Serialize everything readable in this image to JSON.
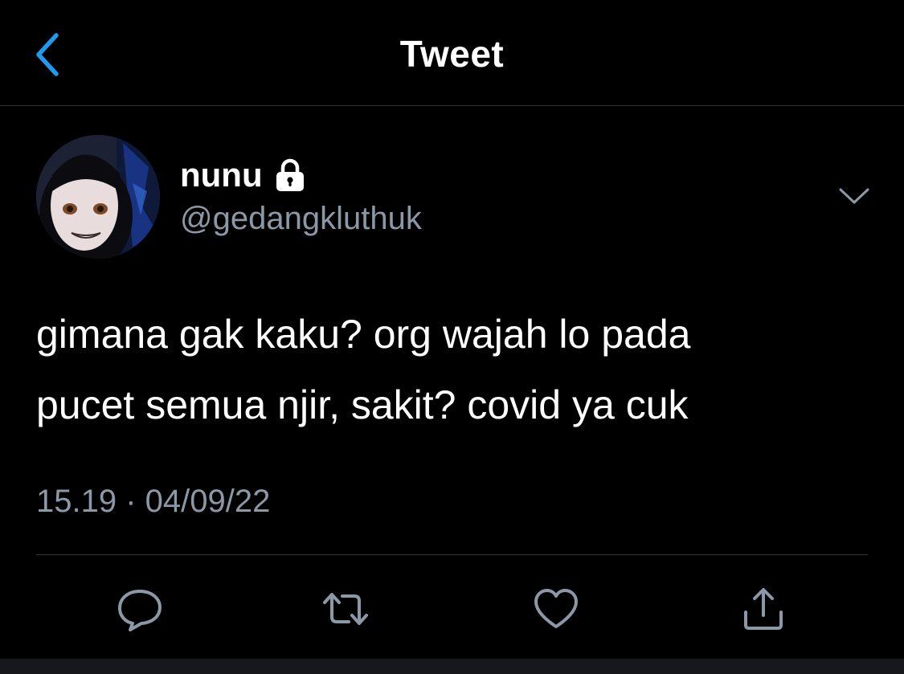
{
  "header": {
    "title": "Tweet",
    "back_icon": "chevron-left-icon",
    "accent_color": "#1d9bf0"
  },
  "tweet": {
    "display_name": "nunu",
    "protected_icon": "lock-icon",
    "handle": "@gedangkluthuk",
    "text": "gimana gak kaku? org wajah lo pada\npucet semua njir, sakit? covid ya cuk",
    "timestamp": "15.19 · 04/09/22",
    "menu_icon": "chevron-down-icon"
  },
  "actions": [
    {
      "name": "reply",
      "icon": "reply-icon"
    },
    {
      "name": "retweet",
      "icon": "retweet-icon"
    },
    {
      "name": "like",
      "icon": "heart-icon"
    },
    {
      "name": "share",
      "icon": "share-icon"
    }
  ],
  "colors": {
    "background": "#000000",
    "text_primary": "#ffffff",
    "text_secondary": "#8b98a5",
    "divider": "#2f3336"
  }
}
